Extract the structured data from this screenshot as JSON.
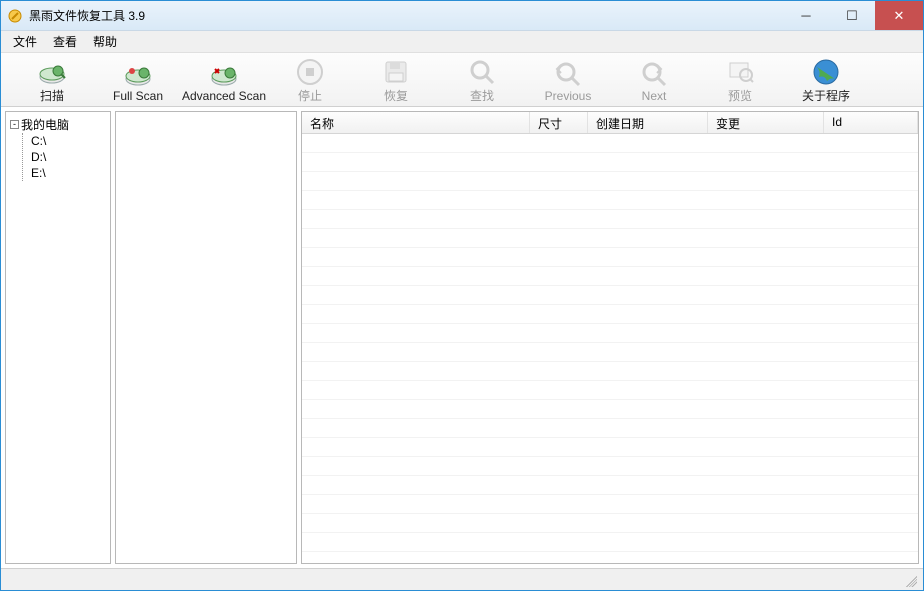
{
  "window": {
    "title": "黑雨文件恢复工具 3.9"
  },
  "menu": {
    "file": "文件",
    "view": "查看",
    "help": "帮助"
  },
  "toolbar": {
    "scan": "扫描",
    "full_scan": "Full Scan",
    "advanced_scan": "Advanced Scan",
    "stop": "停止",
    "recover": "恢复",
    "find": "查找",
    "previous": "Previous",
    "next": "Next",
    "preview": "预览",
    "about": "关于程序"
  },
  "tree": {
    "root": "我的电脑",
    "drives": [
      "C:\\",
      "D:\\",
      "E:\\"
    ]
  },
  "columns": {
    "name": "名称",
    "size": "尺寸",
    "created": "创建日期",
    "changed": "变更",
    "id": "Id"
  }
}
